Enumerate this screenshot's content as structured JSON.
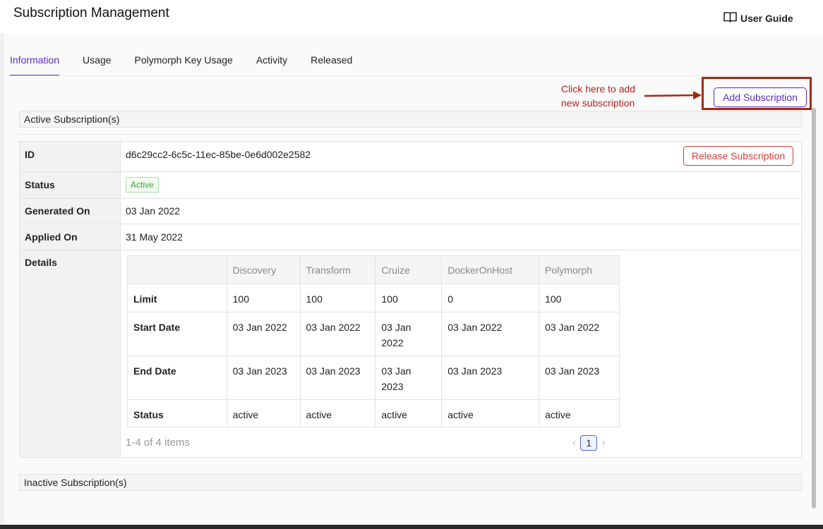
{
  "header": {
    "title": "Subscription Management",
    "user_guide_label": "User Guide",
    "user_guide_icon": "book-icon"
  },
  "tabs": [
    {
      "label": "Information",
      "active": true
    },
    {
      "label": "Usage",
      "active": false
    },
    {
      "label": "Polymorph Key Usage",
      "active": false
    },
    {
      "label": "Activity",
      "active": false
    },
    {
      "label": "Released",
      "active": false
    }
  ],
  "annotation": {
    "line1": "Click here to add",
    "line2": "new subscription"
  },
  "add_subscription_label": "Add Subscription",
  "active_section": {
    "title": "Active Subscription(s)",
    "id_label": "ID",
    "id_value": "d6c29cc2-6c5c-11ec-85be-0e6d002e2582",
    "release_label": "Release Subscription",
    "status_label": "Status",
    "status_value": "Active",
    "generated_label": "Generated On",
    "generated_value": "03 Jan 2022",
    "applied_label": "Applied On",
    "applied_value": "31 May 2022",
    "details_label": "Details",
    "details": {
      "columns": [
        "Discovery",
        "Transform",
        "Cruize",
        "DockerOnHost",
        "Polymorph"
      ],
      "rows": [
        {
          "label": "Limit",
          "values": [
            "100",
            "100",
            "100",
            "0",
            "100"
          ]
        },
        {
          "label": "Start Date",
          "values": [
            "03 Jan 2022",
            "03 Jan 2022",
            "03 Jan 2022",
            "03 Jan 2022",
            "03 Jan 2022"
          ]
        },
        {
          "label": "End Date",
          "values": [
            "03 Jan 2023",
            "03 Jan 2023",
            "03 Jan 2023",
            "03 Jan 2023",
            "03 Jan 2023"
          ]
        },
        {
          "label": "Status",
          "values": [
            "active",
            "active",
            "active",
            "active",
            "active"
          ]
        }
      ]
    },
    "items_count": "1-4 of 4 items",
    "current_page": "1"
  },
  "inactive_section": {
    "title": "Inactive Subscription(s)"
  },
  "colors": {
    "accent": "#5b2bc9",
    "danger": "#d43a3a",
    "annotation": "#b0221e",
    "success": "#2ea52e"
  }
}
